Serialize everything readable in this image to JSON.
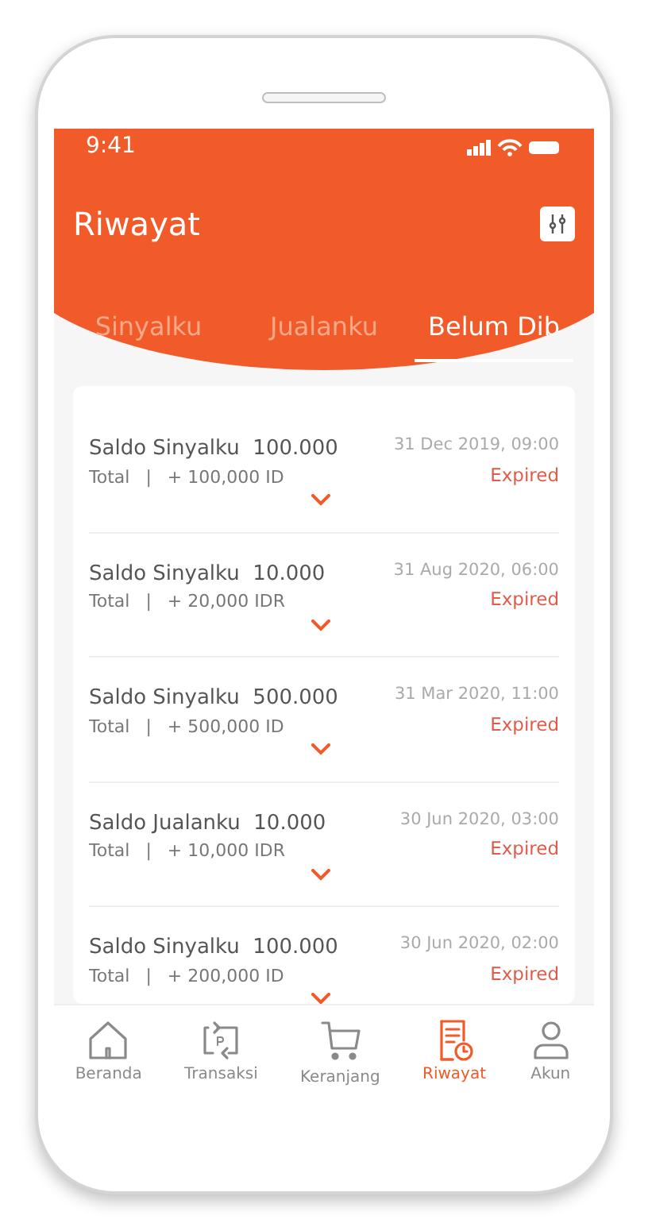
{
  "status_bar": {
    "time": "9:41"
  },
  "header": {
    "title": "Riwayat"
  },
  "tabs": [
    {
      "label": "Sinyalku",
      "selected": false
    },
    {
      "label": "Jualanku",
      "selected": false
    },
    {
      "label": "Belum Dib",
      "selected": true
    }
  ],
  "transactions": [
    {
      "title": "Saldo Sinyalku  100.000",
      "total_label": "Total",
      "separator": "|",
      "total": "+ 100,000 ID",
      "date": "31 Dec 2019, 09:00",
      "status": "Expired"
    },
    {
      "title": "Saldo Sinyalku  10.000",
      "total_label": "Total",
      "separator": "|",
      "total": "+ 20,000 IDR",
      "date": "31 Aug 2020, 06:00",
      "status": "Expired"
    },
    {
      "title": "Saldo Sinyalku  500.000",
      "total_label": "Total",
      "separator": "|",
      "total": "+ 500,000 ID",
      "date": "31 Mar 2020, 11:00",
      "status": "Expired"
    },
    {
      "title": "Saldo Jualanku  10.000",
      "total_label": "Total",
      "separator": "|",
      "total": "+ 10,000 IDR",
      "date": "30 Jun 2020, 03:00",
      "status": "Expired"
    },
    {
      "title": "Saldo Sinyalku  100.000",
      "total_label": "Total",
      "separator": "|",
      "total": "+ 200,000 ID",
      "date": "30 Jun 2020, 02:00",
      "status": "Expired"
    }
  ],
  "bottom_nav": [
    {
      "kind": "home",
      "label": "Beranda",
      "selected": false
    },
    {
      "kind": "transfer",
      "label": "Transaksi",
      "selected": false
    },
    {
      "kind": "cart",
      "label": "Keranjang",
      "selected": false
    },
    {
      "kind": "history",
      "label": "Riwayat",
      "selected": true
    },
    {
      "kind": "account",
      "label": "Akun",
      "selected": false
    }
  ]
}
